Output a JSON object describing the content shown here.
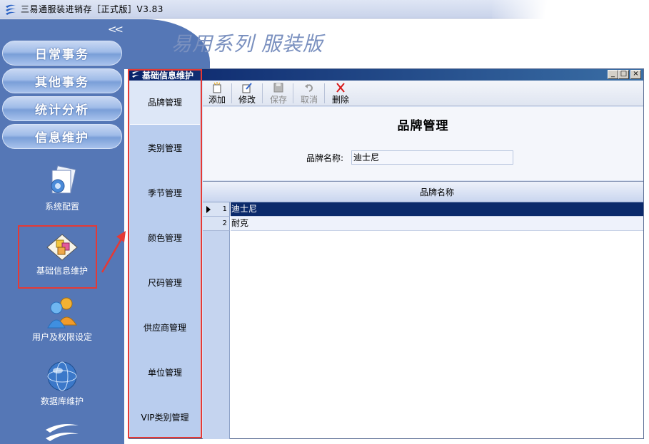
{
  "app": {
    "title": "三易通服装进销存［正式版］V3.83",
    "brand": "易用系列 服装版"
  },
  "sidebar": {
    "collapse": "<<",
    "nav": [
      "日常事务",
      "其他事务",
      "统计分析",
      "信息维护"
    ],
    "items": [
      {
        "label": "系统配置",
        "icon": "system-config-icon"
      },
      {
        "label": "基础信息维护",
        "icon": "basic-info-icon"
      },
      {
        "label": "用户及权限设定",
        "icon": "users-icon"
      },
      {
        "label": "数据库维护",
        "icon": "database-globe-icon"
      }
    ]
  },
  "window": {
    "title": "基础信息维护",
    "controls": [
      "_",
      "□",
      "×"
    ],
    "tabs": [
      "品牌管理",
      "类别管理",
      "季节管理",
      "颜色管理",
      "尺码管理",
      "供应商管理",
      "单位管理",
      "VIP类别管理"
    ],
    "toolbar": [
      {
        "label": "添加",
        "icon": "add-icon",
        "enabled": true
      },
      {
        "label": "修改",
        "icon": "edit-icon",
        "enabled": true
      },
      {
        "label": "保存",
        "icon": "save-icon",
        "enabled": false
      },
      {
        "label": "取消",
        "icon": "undo-icon",
        "enabled": false
      },
      {
        "label": "删除",
        "icon": "delete-icon",
        "enabled": true
      }
    ],
    "form": {
      "title": "品牌管理",
      "label": "品牌名称:",
      "value": "迪士尼"
    },
    "grid": {
      "column": "品牌名称",
      "rows": [
        {
          "num": "1",
          "name": "迪士尼"
        },
        {
          "num": "2",
          "name": "耐克"
        }
      ]
    }
  },
  "colors": {
    "sidebar": "#5577b6",
    "highlight": "#e53935",
    "selection": "#0b2a6b"
  }
}
